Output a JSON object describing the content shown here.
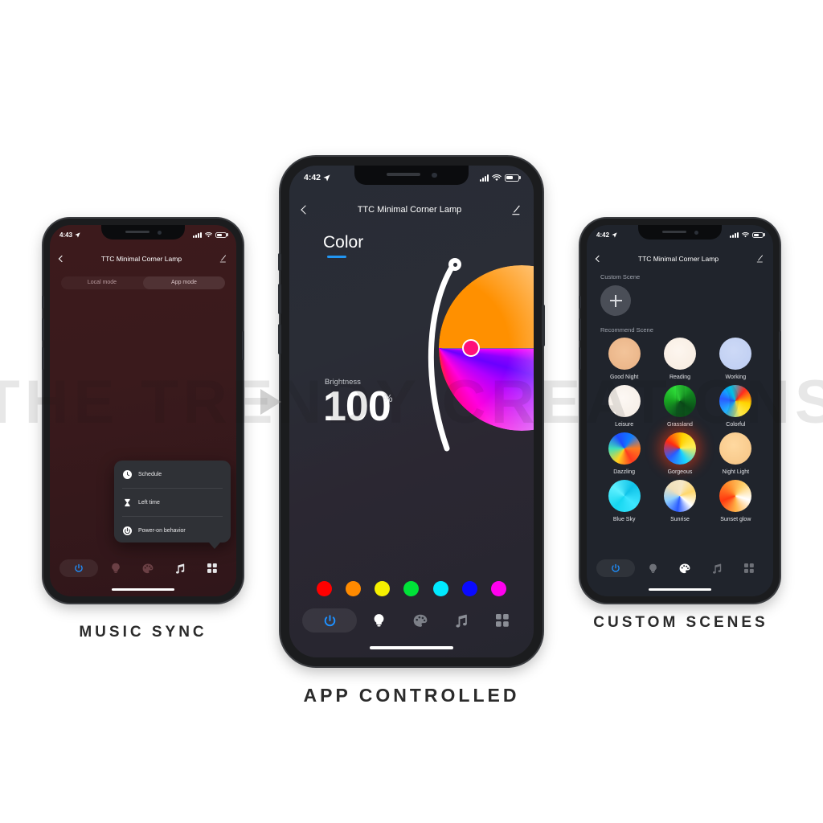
{
  "watermark": {
    "text": "THE TRENDY CREATIONS",
    "play_icon": "play-triangle-icon"
  },
  "captions": {
    "left": "MUSIC SYNC",
    "center": "APP CONTROLLED",
    "right": "CUSTOM SCENES"
  },
  "center_phone": {
    "status_bar": {
      "time": "4:42",
      "location_icon": "location-arrow-icon",
      "signal_icon": "cellular-signal-icon",
      "wifi_icon": "wifi-icon",
      "battery_icon": "battery-icon"
    },
    "nav": {
      "back_icon": "chevron-left-icon",
      "title": "TTC Minimal Corner Lamp",
      "edit_icon": "pencil-edit-icon"
    },
    "tab_label": "Color",
    "brightness": {
      "label": "Brightness",
      "value": "100",
      "unit": "%"
    },
    "swatches": [
      {
        "name": "red",
        "hex": "#ff0000"
      },
      {
        "name": "orange",
        "hex": "#ff8a00"
      },
      {
        "name": "yellow",
        "hex": "#f6f000"
      },
      {
        "name": "green",
        "hex": "#00e238"
      },
      {
        "name": "cyan",
        "hex": "#00eaff"
      },
      {
        "name": "blue",
        "hex": "#0a0aff"
      },
      {
        "name": "magenta",
        "hex": "#ff00ee"
      }
    ],
    "tabbar": [
      {
        "name": "power",
        "icon": "power-icon",
        "active": true
      },
      {
        "name": "light",
        "icon": "bulb-icon",
        "active": true
      },
      {
        "name": "scene",
        "icon": "palette-icon",
        "active": false
      },
      {
        "name": "music",
        "icon": "music-note-icon",
        "active": false
      },
      {
        "name": "more",
        "icon": "grid-squares-icon",
        "active": false
      }
    ]
  },
  "left_phone": {
    "status_bar": {
      "time": "4:43",
      "location_icon": "location-arrow-icon",
      "signal_icon": "cellular-signal-icon",
      "wifi_icon": "wifi-icon",
      "battery_icon": "battery-icon"
    },
    "nav": {
      "back_icon": "chevron-left-icon",
      "title": "TTC Minimal Corner Lamp",
      "edit_icon": "pencil-edit-icon"
    },
    "modes": [
      {
        "label": "Local mode",
        "active": false
      },
      {
        "label": "App mode",
        "active": true
      }
    ],
    "popup_menu": [
      {
        "label": "Schedule",
        "icon": "clock-icon"
      },
      {
        "label": "Left time",
        "icon": "hourglass-icon"
      },
      {
        "label": "Power-on behavior",
        "icon": "power-behavior-icon"
      }
    ],
    "tabbar": [
      {
        "name": "power",
        "icon": "power-icon",
        "active": true
      },
      {
        "name": "light",
        "icon": "bulb-icon",
        "active": false
      },
      {
        "name": "scene",
        "icon": "palette-icon",
        "active": false
      },
      {
        "name": "music",
        "icon": "music-note-icon",
        "active": true
      },
      {
        "name": "more",
        "icon": "grid-squares-icon",
        "active": true
      }
    ]
  },
  "right_phone": {
    "status_bar": {
      "time": "4:42",
      "location_icon": "location-arrow-icon",
      "signal_icon": "cellular-signal-icon",
      "wifi_icon": "wifi-icon",
      "battery_icon": "battery-icon"
    },
    "nav": {
      "back_icon": "chevron-left-icon",
      "title": "TTC Minimal Corner Lamp",
      "edit_icon": "pencil-edit-icon"
    },
    "custom_scene_label": "Custom Scene",
    "add_button_icon": "plus-icon",
    "recommend_scene_label": "Recommend Scene",
    "scenes": [
      {
        "label": "Good Night",
        "css": "radial-gradient(circle at 50% 45%, #f3c49a 0%, #e8b184 100%)",
        "glow": false
      },
      {
        "label": "Reading",
        "css": "radial-gradient(circle at 45% 40%, #fdf6ef 0%, #f6eade 100%)",
        "glow": false
      },
      {
        "label": "Working",
        "css": "radial-gradient(circle at 45% 40%, #cdd9f6 0%, #bdcdf2 100%)",
        "glow": false
      },
      {
        "label": "Leisure",
        "css": "radial-gradient(circle at 45% 40%, #fdf8f4 0%, #f4ece4 100%)",
        "glow": false
      },
      {
        "label": "Grassland",
        "css": "conic-gradient(from 200deg, #0d5c1e, #18a321, #2fe03a, #11851f, #0a4d18, #0d5c1e)",
        "glow": false
      },
      {
        "label": "Colorful",
        "css": "conic-gradient(from 40deg, #ff2a1f, #ffd400, #ffe84a, #22b6ff, #2a5bff, #00d5ff, #ff2a1f)",
        "glow": false
      },
      {
        "label": "Dazzling",
        "css": "conic-gradient(from 150deg, #ff3b1f, #ffd21f, #3fe0b8, #1f4bff, #0e7dff, #ff7a1f, #ff3b1f)",
        "glow": false
      },
      {
        "label": "Gorgeous",
        "css": "conic-gradient(from 300deg, #ff2a12, #ffd000, #ffee55, #19d4ff, #2a5bff, #ff2a12)",
        "glow": true
      },
      {
        "label": "Night Light",
        "css": "radial-gradient(circle at 45% 40%, #ffd9a0 0%, #f5c383 100%)",
        "glow": false
      },
      {
        "label": "Blue Sky",
        "css": "conic-gradient(from 220deg, #16d7f0, #5ef0ff, #0fc2e8, #3de6ff, #16d7f0)",
        "glow": false
      },
      {
        "label": "Sunrise",
        "css": "conic-gradient(from 10deg, #f6e8c8, #ffd76a, #ffffff, #2a5bff, #8fd0ff, #f0e0bb, #f6e8c8)",
        "glow": false
      },
      {
        "label": "Sunset glow",
        "css": "conic-gradient(from 250deg, #ff3a10, #ff8a2a, #ffd06a, #ffffff, #ffb347, #ff3a10)",
        "glow": false
      }
    ],
    "tabbar": [
      {
        "name": "power",
        "icon": "power-icon",
        "active": true
      },
      {
        "name": "light",
        "icon": "bulb-icon",
        "active": false
      },
      {
        "name": "scene",
        "icon": "palette-icon",
        "active": true
      },
      {
        "name": "music",
        "icon": "music-note-icon",
        "active": false
      },
      {
        "name": "more",
        "icon": "grid-squares-icon",
        "active": false
      }
    ]
  }
}
